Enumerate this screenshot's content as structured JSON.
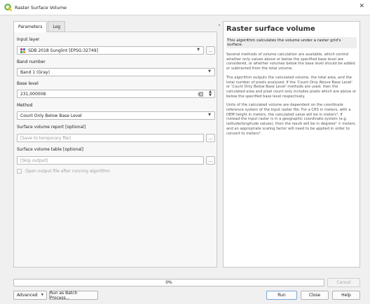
{
  "window": {
    "title": "Raster Surface Volume"
  },
  "tabs": [
    {
      "label": "Parameters"
    },
    {
      "label": "Log"
    }
  ],
  "params": {
    "input_layer": {
      "label": "Input layer",
      "value": "SDB 2018 Sunglint [EPSG:32749]"
    },
    "band": {
      "label": "Band number",
      "value": "Band 1 (Gray)"
    },
    "base_level": {
      "label": "Base level",
      "value": "231,000008"
    },
    "method": {
      "label": "Method",
      "value": "Count Only Below Base Level"
    },
    "report": {
      "label": "Surface volume report [optional]",
      "value": "[Save to temporary file]"
    },
    "table": {
      "label": "Surface volume table [optional]",
      "value": "[Skip output]"
    },
    "open_after": {
      "label": "Open output file after running algorithm"
    }
  },
  "browse_label": "…",
  "help": {
    "title": "Raster surface volume",
    "subtitle": "This algorithm calculates the volume under a raster grid's surface.",
    "paragraphs": [
      "Several methods of volume calculation are available, which control whether only values above or below the specified base level are considered, or whether volumes below the base level should be added or subtracted from the total volume.",
      "The algorithm outputs the calculated volume, the total area, and the total number of pixels analysed. If the 'Count Only Above Base Level' or 'Count Only Below Base Level' methods are used, then the calculated area and pixel count only includes pixels which are above or below the specified base level respectively.",
      "Units of the calculated volume are dependent on the coordinate reference system of the input raster file. For a CRS in meters, with a DEM height in meters, the calculated value will be in meters³. If instead the input raster is in a geographic coordinate system (e.g. latitude/longitude values), then the result will be in degrees² × meters, and an appropriate scaling factor will need to be applied in order to convert to meters³."
    ]
  },
  "progress": {
    "value": 0,
    "label": "0%"
  },
  "buttons": {
    "cancel": "Cancel",
    "advanced": "Advanced",
    "batch": "Run as Batch Process...",
    "run": "Run",
    "close": "Close",
    "help": "Help"
  },
  "colors": {
    "logo_green": "#6cb33f",
    "accent": "#7aa4d9"
  }
}
